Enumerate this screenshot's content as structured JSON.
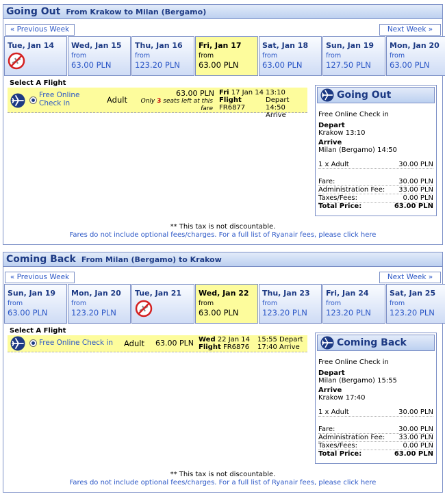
{
  "outbound": {
    "title": "Going Out",
    "route": "From Krakow to Milan (Bergamo)",
    "prev_week": "« Previous Week",
    "next_week": "Next Week »",
    "days": [
      {
        "name": "Tue, Jan 14",
        "from": "",
        "price": "",
        "available": false,
        "selected": false
      },
      {
        "name": "Wed, Jan 15",
        "from": "from",
        "price": "63.00 PLN",
        "available": true,
        "selected": false
      },
      {
        "name": "Thu, Jan 16",
        "from": "from",
        "price": "123.20 PLN",
        "available": true,
        "selected": false
      },
      {
        "name": "Fri, Jan 17",
        "from": "from",
        "price": "63.00 PLN",
        "available": true,
        "selected": true
      },
      {
        "name": "Sat, Jan 18",
        "from": "from",
        "price": "63.00 PLN",
        "available": true,
        "selected": false
      },
      {
        "name": "Sun, Jan 19",
        "from": "from",
        "price": "127.50 PLN",
        "available": true,
        "selected": false
      },
      {
        "name": "Mon, Jan 20",
        "from": "from",
        "price": "63.00 PLN",
        "available": true,
        "selected": false
      }
    ],
    "select_label": "Select A Flight",
    "flight": {
      "checkin": "Free Online Check in",
      "fare_type": "Adult",
      "price": "63.00 PLN",
      "seats_prefix": "Only",
      "seats_count": "3",
      "seats_suffix": "seats left at this",
      "seats_line2": "fare",
      "date_day": "Fri",
      "date": "17 Jan 14",
      "flight_label": "Flight",
      "flight_no": "FR6877",
      "depart_time": "13:10",
      "depart_label": "Depart",
      "arrive_time": "14:50",
      "arrive_label": "Arrive"
    },
    "panel": {
      "title": "Going Out",
      "checkin": "Free Online Check in",
      "depart_label": "Depart",
      "depart_value": "Krakow 13:10",
      "arrive_label": "Arrive",
      "arrive_value": "Milan (Bergamo) 14:50",
      "pax_label": "1 x Adult",
      "pax_value": "30.00 PLN",
      "fare_label": "Fare:",
      "fare_value": "30.00 PLN",
      "admin_label": "Administration Fee:",
      "admin_value": "33.00 PLN",
      "taxes_label": "Taxes/Fees:",
      "taxes_value": "0.00 PLN",
      "total_label": "Total Price:",
      "total_value": "63.00 PLN"
    },
    "note1": "** This tax is not discountable.",
    "note2": "Fares do not include optional fees/charges. For a full list of Ryanair fees, please click here"
  },
  "inbound": {
    "title": "Coming Back",
    "route": "From Milan (Bergamo) to Krakow",
    "prev_week": "« Previous Week",
    "next_week": "Next Week »",
    "days": [
      {
        "name": "Sun, Jan 19",
        "from": "from",
        "price": "63.00 PLN",
        "available": true,
        "selected": false
      },
      {
        "name": "Mon, Jan 20",
        "from": "from",
        "price": "123.20 PLN",
        "available": true,
        "selected": false
      },
      {
        "name": "Tue, Jan 21",
        "from": "",
        "price": "",
        "available": false,
        "selected": false
      },
      {
        "name": "Wed, Jan 22",
        "from": "from",
        "price": "63.00 PLN",
        "available": true,
        "selected": true
      },
      {
        "name": "Thu, Jan 23",
        "from": "from",
        "price": "123.20 PLN",
        "available": true,
        "selected": false
      },
      {
        "name": "Fri, Jan 24",
        "from": "from",
        "price": "123.20 PLN",
        "available": true,
        "selected": false
      },
      {
        "name": "Sat, Jan 25",
        "from": "from",
        "price": "123.20 PLN",
        "available": true,
        "selected": false
      }
    ],
    "select_label": "Select A Flight",
    "flight": {
      "checkin": "Free Online Check in",
      "fare_type": "Adult",
      "price": "63.00 PLN",
      "date_day": "Wed",
      "date": "22 Jan 14",
      "flight_label": "Flight",
      "flight_no": "FR6876",
      "depart_time": "15:55",
      "depart_label": "Depart",
      "arrive_time": "17:40",
      "arrive_label": "Arrive"
    },
    "panel": {
      "title": "Coming Back",
      "checkin": "Free Online Check in",
      "depart_label": "Depart",
      "depart_value": "Milan (Bergamo) 15:55",
      "arrive_label": "Arrive",
      "arrive_value": "Krakow 17:40",
      "pax_label": "1 x Adult",
      "pax_value": "30.00 PLN",
      "fare_label": "Fare:",
      "fare_value": "30.00 PLN",
      "admin_label": "Administration Fee:",
      "admin_value": "33.00 PLN",
      "taxes_label": "Taxes/Fees:",
      "taxes_value": "0.00 PLN",
      "total_label": "Total Price:",
      "total_value": "63.00 PLN"
    },
    "note1": "** This tax is not discountable.",
    "note2": "Fares do not include optional fees/charges. For a full list of Ryanair fees, please click here"
  }
}
